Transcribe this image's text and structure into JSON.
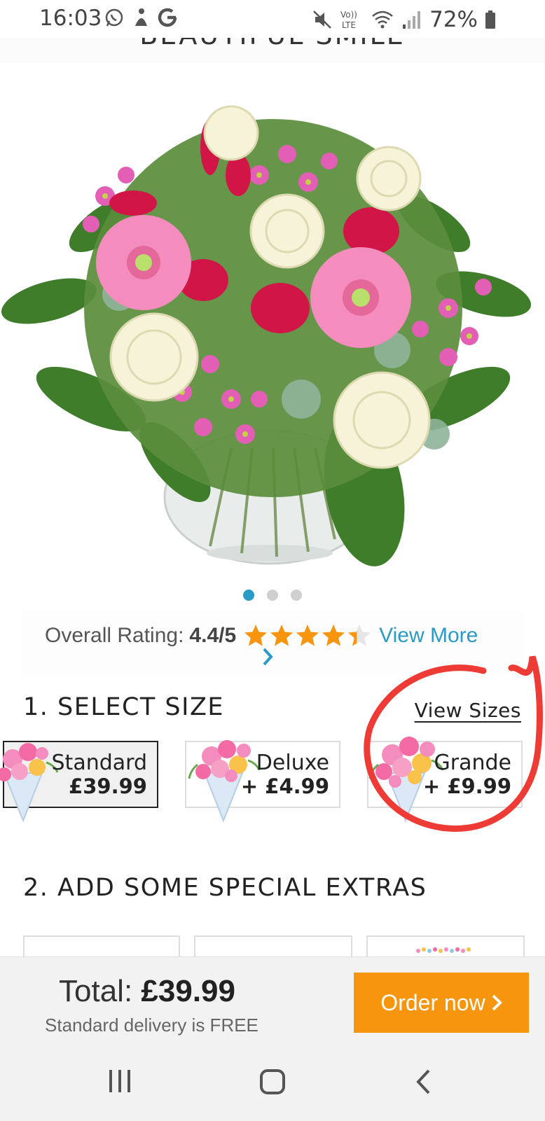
{
  "status_bar": {
    "time": "16:03",
    "battery": "72%",
    "left_icons": [
      "whatsapp-icon",
      "app-icon",
      "google-icon"
    ],
    "right_icons": [
      "mute-icon",
      "volte-icon",
      "wifi-icon",
      "signal-icon",
      "battery-icon"
    ],
    "volte_label": "Vo)) LTE"
  },
  "product": {
    "title": "BEAUTIFUL SMILE",
    "gallery_pages": 3,
    "gallery_active_index": 0
  },
  "rating": {
    "label": "Overall Rating:",
    "value": "4.4/5",
    "stars_value": 4.4,
    "stars_max": 5,
    "view_more": "View More",
    "star_color": "#f7950e",
    "link_color": "#2a9bc7"
  },
  "size_section": {
    "title": "1. SELECT SIZE",
    "view_sizes": "View  Sizes",
    "options": [
      {
        "name": "Standard",
        "price": "£39.99",
        "selected": true
      },
      {
        "name": "Deluxe",
        "price": "+ £4.99",
        "selected": false
      },
      {
        "name": "Grande",
        "price": "+ £9.99",
        "selected": false
      }
    ]
  },
  "extras_section": {
    "title": "2. ADD SOME SPECIAL EXTRAS"
  },
  "bottom_bar": {
    "total_label": "Total:",
    "total_value": "£39.99",
    "delivery_note": "Standard delivery is FREE",
    "order_button": "Order now",
    "accent_color": "#f7950e"
  },
  "nav_bar": {
    "buttons": [
      "recents-icon",
      "home-icon",
      "back-icon"
    ]
  },
  "annotation": {
    "type": "hand-drawn circle",
    "color": "#ee3b35",
    "target": "Grande"
  }
}
